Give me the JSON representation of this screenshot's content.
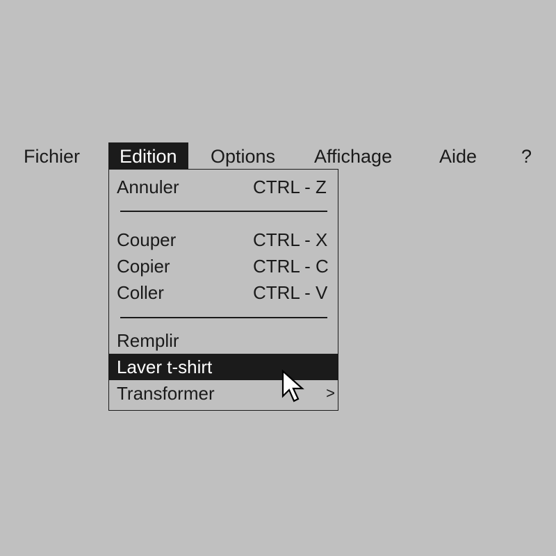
{
  "menubar": {
    "items": [
      {
        "label": "Fichier"
      },
      {
        "label": "Edition"
      },
      {
        "label": "Options"
      },
      {
        "label": "Affichage"
      },
      {
        "label": "Aide"
      },
      {
        "label": "?"
      }
    ]
  },
  "edition_menu": {
    "undo": {
      "label": "Annuler",
      "shortcut": "CTRL - Z"
    },
    "cut": {
      "label": "Couper",
      "shortcut": "CTRL - X"
    },
    "copy": {
      "label": "Copier",
      "shortcut": "CTRL - C"
    },
    "paste": {
      "label": "Coller",
      "shortcut": "CTRL - V"
    },
    "fill": {
      "label": "Remplir"
    },
    "wash": {
      "label": "Laver t-shirt"
    },
    "transform": {
      "label": "Transformer",
      "submenu_indicator": ">"
    }
  },
  "colors": {
    "background": "#c0c0c0",
    "highlight": "#1b1b1b",
    "highlight_text": "#ffffff",
    "text": "#1a1a1a"
  },
  "icons": {
    "cursor": "arrow-pointer-icon"
  }
}
